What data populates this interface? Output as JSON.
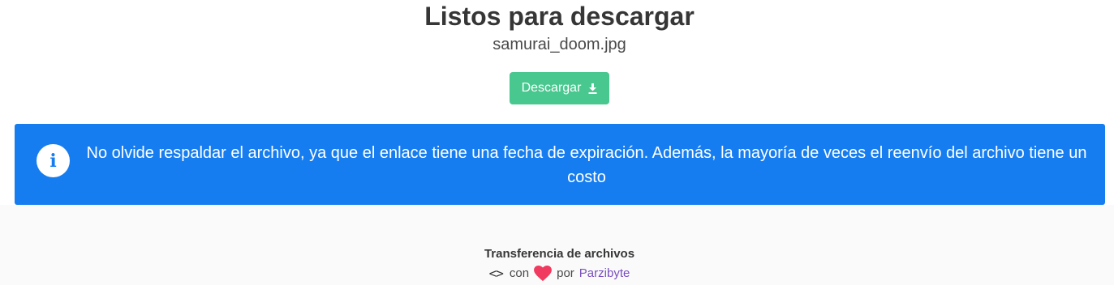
{
  "header": {
    "title": "Listos para descargar",
    "filename": "samurai_doom.jpg"
  },
  "download": {
    "label": "Descargar",
    "icon": "download-icon",
    "color": "#48c78e"
  },
  "notice": {
    "icon": "info-icon",
    "text": "No olvide respaldar el archivo, ya que el enlace tiene una fecha de expiración. Además, la mayoría de veces el reenvío del archivo tiene un costo",
    "color": "#167df0"
  },
  "footer": {
    "title": "Transferencia de archivos",
    "code_icon": "code-icon",
    "con": "con",
    "heart_icon": "heart-icon",
    "por": "por",
    "author_link": "Parzibyte",
    "link_color": "#7a4fbf",
    "heart_color": "#f03a5f"
  }
}
